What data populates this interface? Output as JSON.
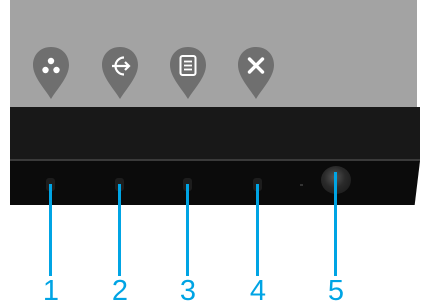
{
  "osd": {
    "icons": [
      {
        "name": "preset-modes-icon",
        "glyph": "three-dots"
      },
      {
        "name": "input-source-icon",
        "glyph": "arrow-in-circle"
      },
      {
        "name": "menu-icon",
        "glyph": "document-lines"
      },
      {
        "name": "exit-icon",
        "glyph": "x"
      }
    ],
    "pin_color": "#6f6f6f",
    "glyph_color": "#ffffff"
  },
  "buttons": {
    "labels": [
      "1",
      "2",
      "3",
      "4",
      "5"
    ],
    "callout_color": "#00a4e4"
  }
}
